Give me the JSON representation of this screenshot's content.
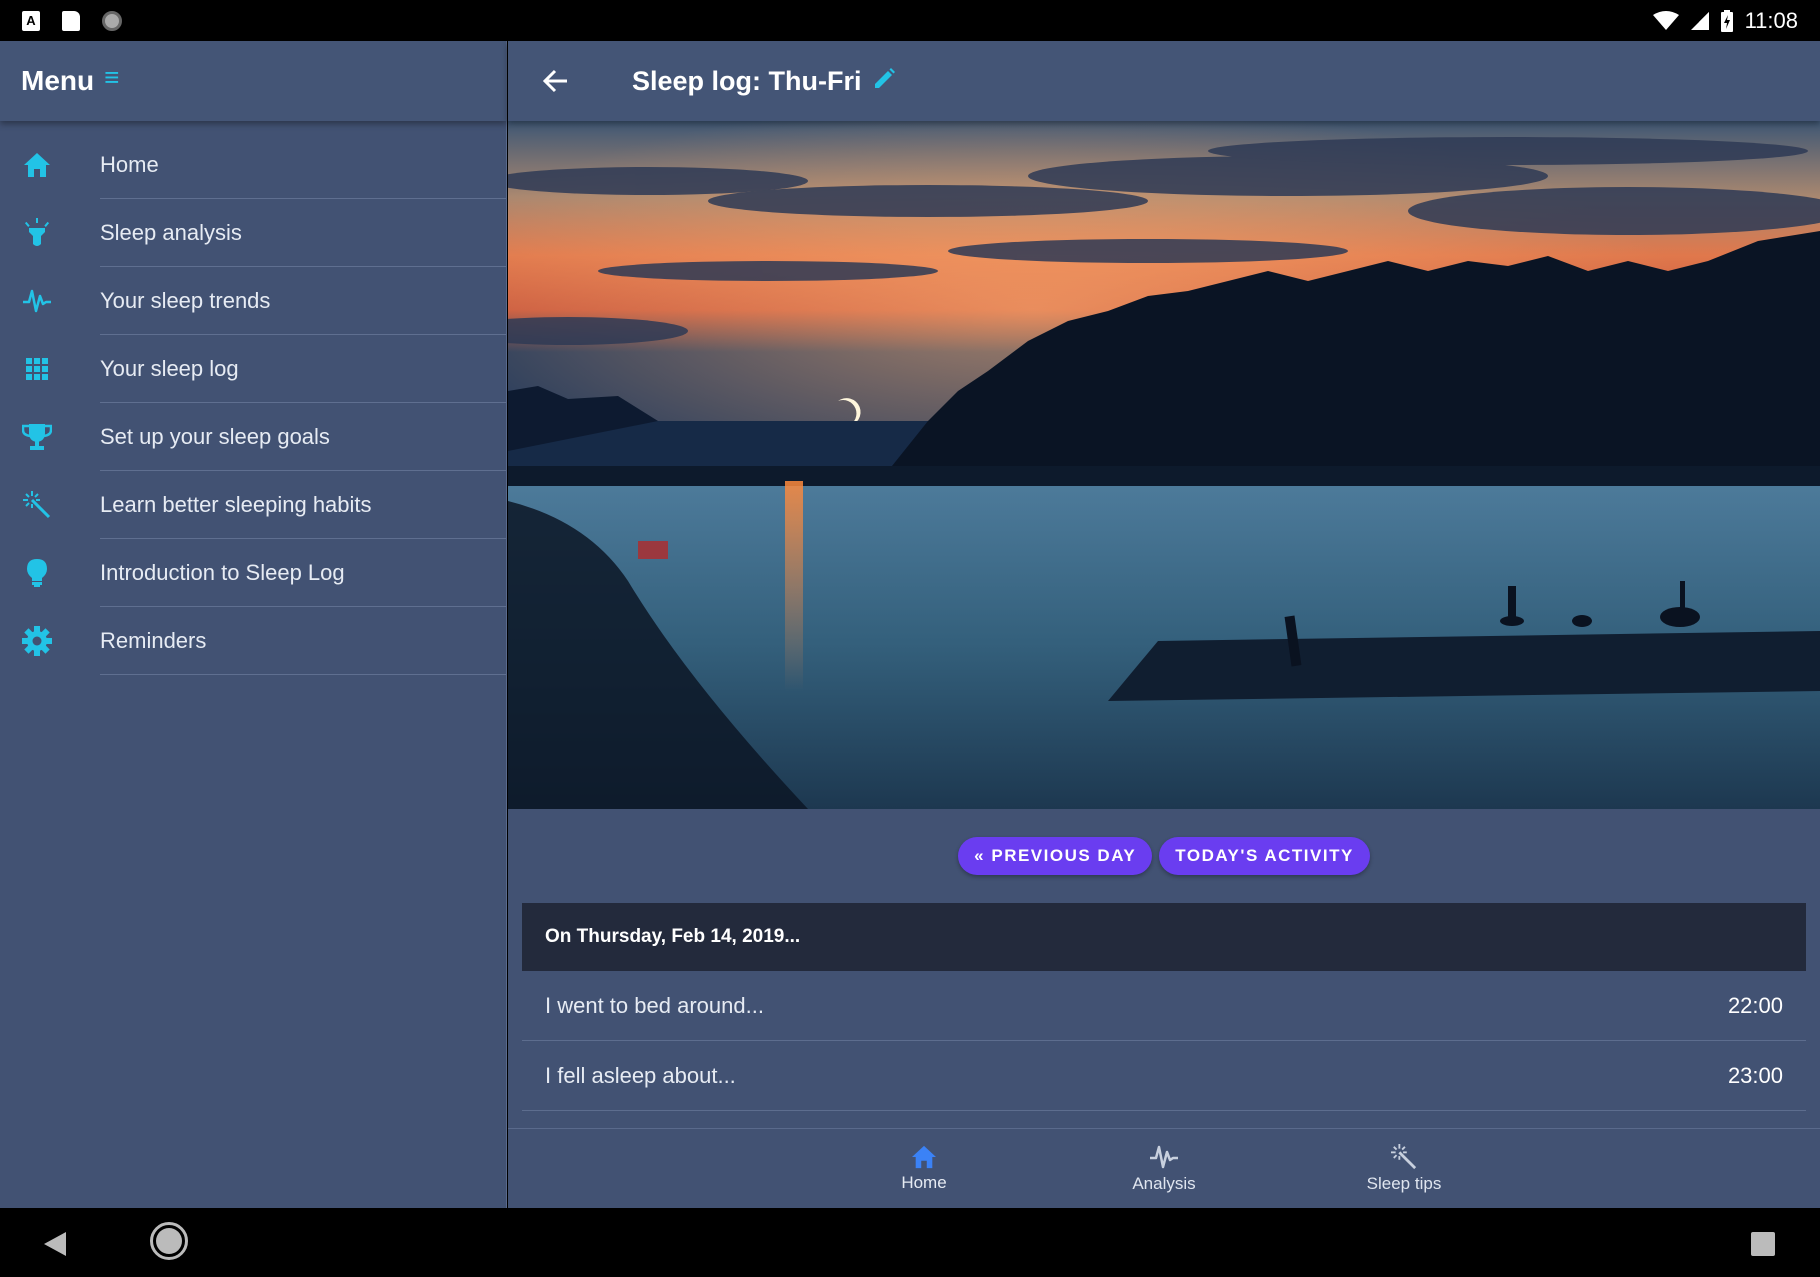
{
  "status_bar": {
    "time": "11:08",
    "left_icons": [
      "notification-a-icon",
      "sd-card-icon",
      "sync-circle-icon"
    ],
    "right_icons": [
      "wifi-icon",
      "signal-icon",
      "battery-charging-icon"
    ],
    "a_glyph": "A"
  },
  "sidebar": {
    "title": "Menu",
    "menu_icon": "≡",
    "items": [
      {
        "label": "Home",
        "icon": "home-icon"
      },
      {
        "label": "Sleep analysis",
        "icon": "lightbulb-rays-icon"
      },
      {
        "label": "Your sleep trends",
        "icon": "pulse-icon"
      },
      {
        "label": "Your sleep log",
        "icon": "grid-icon"
      },
      {
        "label": "Set up your sleep goals",
        "icon": "trophy-icon"
      },
      {
        "label": "Learn better sleeping habits",
        "icon": "magic-wand-icon"
      },
      {
        "label": "Introduction to Sleep Log",
        "icon": "lightbulb-icon"
      },
      {
        "label": "Reminders",
        "icon": "gear-icon"
      }
    ]
  },
  "header": {
    "title": "Sleep log: Thu-Fri"
  },
  "buttons": {
    "previous_day": "« PREVIOUS DAY",
    "todays_activity": "TODAY'S ACTIVITY"
  },
  "log": {
    "date_header": "On Thursday, Feb 14, 2019...",
    "rows": [
      {
        "label": "I went to bed around...",
        "value": "22:00"
      },
      {
        "label": "I fell asleep about...",
        "value": "23:00"
      }
    ]
  },
  "bottom_nav": [
    {
      "label": "Home",
      "icon": "home-icon"
    },
    {
      "label": "Analysis",
      "icon": "pulse-icon"
    },
    {
      "label": "Sleep tips",
      "icon": "magic-wand-icon"
    }
  ],
  "colors": {
    "accent": "#22c3e6",
    "panel": "#425273",
    "header": "#445576",
    "button": "#6a3df0",
    "card_header": "#232a3c",
    "active_nav": "#3b82f6"
  }
}
